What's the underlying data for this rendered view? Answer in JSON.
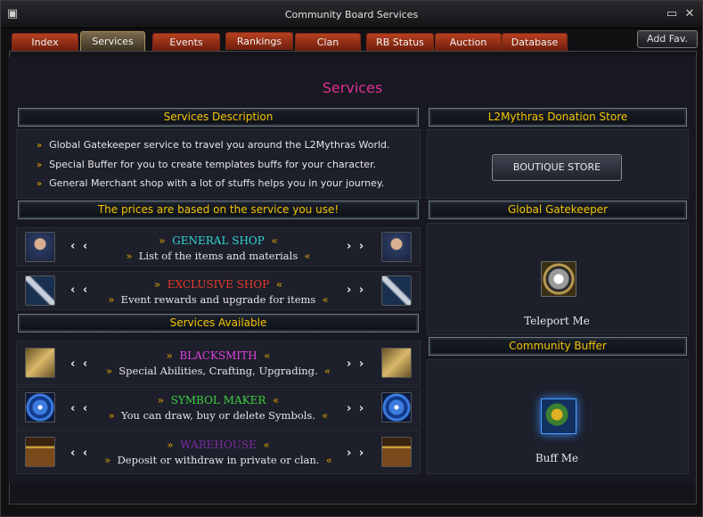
{
  "window": {
    "title": "Community Board Services",
    "add_fav": "Add Fav."
  },
  "tabs": [
    "Index",
    "Services",
    "Events",
    "Rankings",
    "Clan",
    "RB Status",
    "Auction",
    "Database"
  ],
  "page_heading": "Services",
  "services_description": {
    "header": "Services Description",
    "items": [
      "Global Gatekeeper service to travel you around the L2Mythras World.",
      "Special Buffer for you to create templates buffs for your character.",
      "General Merchant shop with a lot of stuffs helps you in your journey."
    ]
  },
  "prices_header": "The prices are based on the service you use!",
  "shops": [
    {
      "title": "GENERAL SHOP",
      "subtitle": "List of the items and materials",
      "title_color": "#2fd6d6",
      "icon": "knight-portrait-icon"
    },
    {
      "title": "EXCLUSIVE SHOP",
      "subtitle": "Event rewards and upgrade for items",
      "title_color": "#e83c2a",
      "icon": "crossed-weapons-icon"
    }
  ],
  "services_available_header": "Services Available",
  "services": [
    {
      "title": "BLACKSMITH",
      "subtitle": "Special Abilities, Crafting, Upgrading.",
      "title_color": "#e040e0",
      "icon": "hammer-icon"
    },
    {
      "title": "SYMBOL MAKER",
      "subtitle": "You can draw, buy or delete Symbols.",
      "title_color": "#3ecf3e",
      "icon": "snowflake-symbol-icon"
    },
    {
      "title": "WAREHOUSE",
      "subtitle": "Deposit or withdraw in private or clan.",
      "title_color": "#7a2ea0",
      "icon": "treasure-chest-icon"
    }
  ],
  "donation_store": {
    "header": "L2Mythras Donation Store",
    "button": "BOUTIQUE STORE"
  },
  "gatekeeper": {
    "header": "Global Gatekeeper",
    "caption": "Teleport Me",
    "icon": "teleport-crystal-icon"
  },
  "buffer": {
    "header": "Community Buffer",
    "caption": "Buff Me",
    "icon": "warrior-buff-icon"
  },
  "glyphs": {
    "chev": "»",
    "chev_right": "«",
    "left_arrows": "‹ ‹",
    "right_arrows": "› ›",
    "close": "✕",
    "minimize": "▭"
  }
}
